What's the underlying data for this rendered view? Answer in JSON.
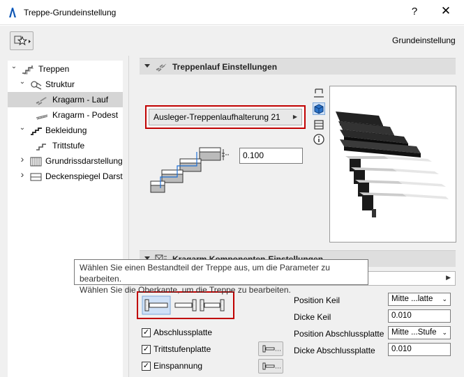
{
  "window": {
    "title": "Treppe-Grundeinstellung",
    "help": "?",
    "close": "✕"
  },
  "header": {
    "label": "Grundeinstellung"
  },
  "tree": [
    {
      "label": "Treppen",
      "arrow": "⌄"
    },
    {
      "label": "Struktur",
      "arrow": "⌄"
    },
    {
      "label": "Kragarm - Lauf",
      "arrow": ""
    },
    {
      "label": "Kragarm - Podest",
      "arrow": ""
    },
    {
      "label": "Bekleidung",
      "arrow": "⌄"
    },
    {
      "label": "Trittstufe",
      "arrow": ""
    },
    {
      "label": "Grundrissdarstellung",
      "arrow": "›"
    },
    {
      "label": "Deckenspiegel Darste",
      "arrow": "›"
    }
  ],
  "section1": {
    "title": "Treppenlauf Einstellungen"
  },
  "stair_selector": {
    "value": "Ausleger-Treppenlaufhalterung 21",
    "caret": "▶"
  },
  "thickness_value": "0.100",
  "section2": {
    "title": "Kragarm Komponenten-Einstellungen"
  },
  "tooltip": {
    "line1": "Wählen Sie einen Bestandteil der Treppe aus, um die Parameter zu bearbeiten.",
    "line2": "Wählen Sie die Oberkante, um die Treppe zu bearbeiten."
  },
  "checkboxes": [
    {
      "label": "Abschlussplatte",
      "checked": "✓"
    },
    {
      "label": "Trittstufenplatte",
      "checked": "✓"
    },
    {
      "label": "Einspannung",
      "checked": "✓"
    }
  ],
  "params": [
    {
      "label": "Position Keil",
      "value": "Mitte ...latte",
      "dropdown": true
    },
    {
      "label": "Dicke Keil",
      "value": "0.010",
      "dropdown": false
    },
    {
      "label": "Position Abschlussplatte",
      "value": "Mitte ...Stufe",
      "dropdown": true
    },
    {
      "label": "Dicke Abschlussplatte",
      "value": "0.010",
      "dropdown": false
    }
  ],
  "colors": {
    "highlight": "#c00000",
    "selected_bg": "#d5d5d5",
    "section_bg": "#dedede",
    "accent": "#1e6fd4"
  }
}
